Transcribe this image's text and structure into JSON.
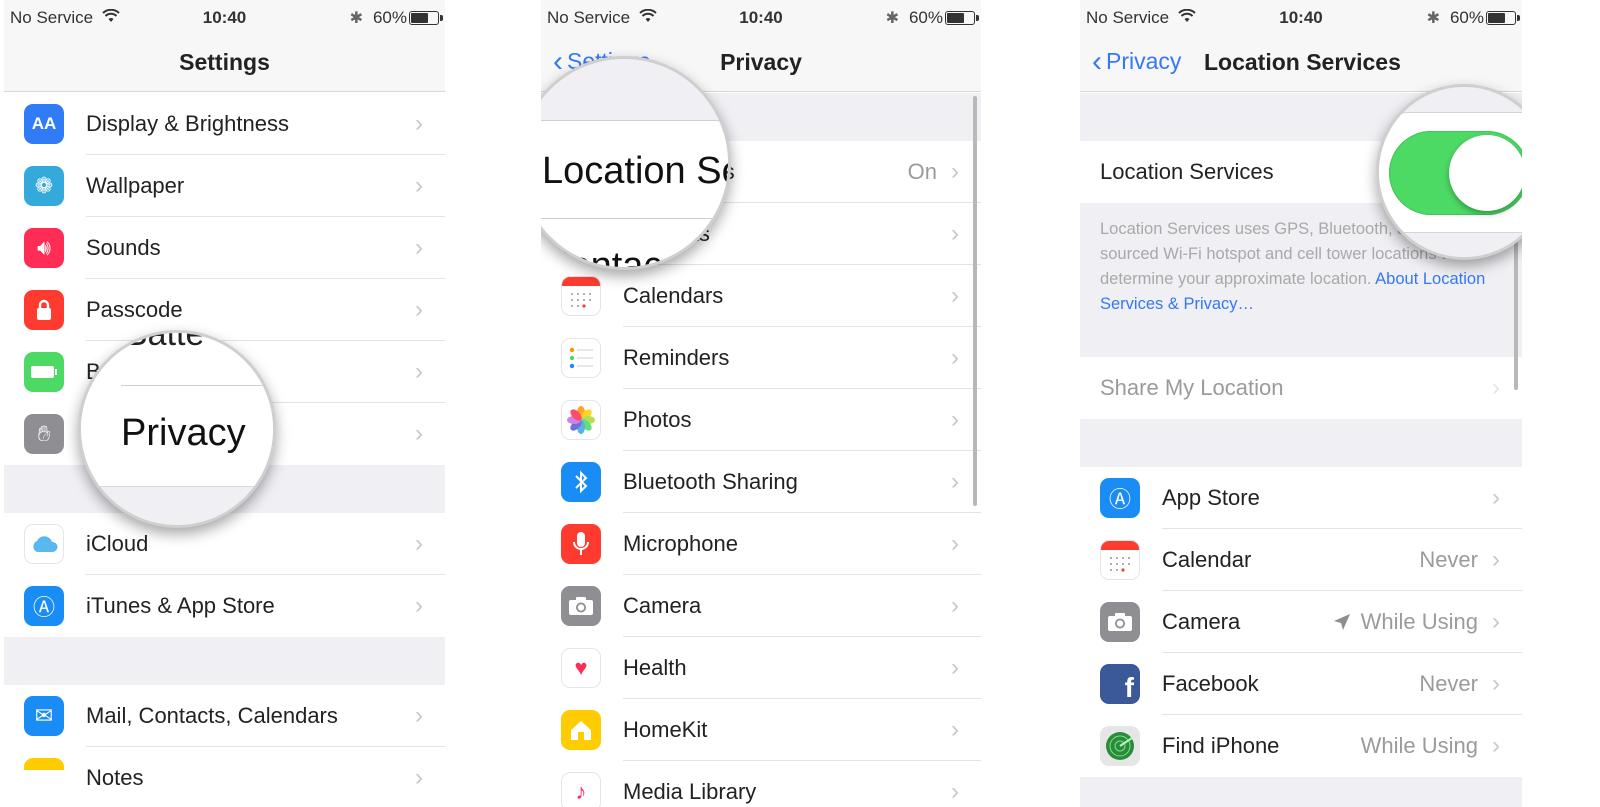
{
  "status": {
    "carrier": "No Service",
    "time": "10:40",
    "battery": "60%",
    "battery_level": 0.6
  },
  "panel1": {
    "title": "Settings",
    "rows": [
      {
        "label": "Display & Brightness",
        "icon": "display-brightness-icon",
        "color": "#2f7cf6"
      },
      {
        "label": "Wallpaper",
        "icon": "wallpaper-flower-icon",
        "color": "#34aadc"
      },
      {
        "label": "Sounds",
        "icon": "sounds-speaker-icon",
        "color": "#ff2d55"
      },
      {
        "label": "Passcode",
        "icon": "passcode-lock-icon",
        "color": "#ff3b30"
      },
      {
        "label": "B",
        "icon": "battery-icon",
        "color": "#4cd964"
      },
      {
        "label": "",
        "icon": "privacy-hand-icon",
        "color": "#8e8e93"
      },
      {
        "label": "iCloud",
        "icon": "icloud-icon",
        "color": "#ffffff"
      },
      {
        "label": "iTunes & App Store",
        "icon": "app-store-icon",
        "color": "#1a8cf5"
      },
      {
        "label": "Mail, Contacts, Calendars",
        "icon": "mail-icon",
        "color": "#1a8cf5"
      },
      {
        "label": "Notes",
        "icon": "notes-icon",
        "color": "#ffcc00"
      }
    ],
    "magnifier": {
      "label": "Privacy",
      "above": "Batte"
    }
  },
  "panel2": {
    "back": "Settings",
    "title": "Privacy",
    "rows": [
      {
        "label": "Location Services",
        "value": "On",
        "icon": "",
        "color": ""
      },
      {
        "label": "Contacts",
        "icon": "contacts-icon",
        "color": "#8e8e93"
      },
      {
        "label": "Calendars",
        "icon": "calendar-icon",
        "color": "#ffffff"
      },
      {
        "label": "Reminders",
        "icon": "reminders-icon",
        "color": "#ffffff"
      },
      {
        "label": "Photos",
        "icon": "photos-icon",
        "color": "#ffffff"
      },
      {
        "label": "Bluetooth Sharing",
        "icon": "bluetooth-icon",
        "color": "#1a8cf5"
      },
      {
        "label": "Microphone",
        "icon": "microphone-icon",
        "color": "#ff3b30"
      },
      {
        "label": "Camera",
        "icon": "camera-icon",
        "color": "#8e8e93"
      },
      {
        "label": "Health",
        "icon": "health-heart-icon",
        "color": "#ffffff"
      },
      {
        "label": "HomeKit",
        "icon": "homekit-house-icon",
        "color": "#ffcc00"
      },
      {
        "label": "Media Library",
        "icon": "music-icon",
        "color": "#ffffff"
      }
    ],
    "magnifier": {
      "label": "Location Se",
      "below": "Contac"
    }
  },
  "panel3": {
    "back": "Privacy",
    "title": "Location Services",
    "toggle_label": "Location Services",
    "toggle_on": true,
    "description": "Location Services uses GPS, Bluetooth, and crowd-sourced Wi-Fi hotspot and cell tower locations to determine your approximate location.",
    "description_link": "About Location Services & Privacy…",
    "share_label": "Share My Location",
    "apps": [
      {
        "label": "App Store",
        "value": "",
        "icon": "app-store-icon",
        "color": "#1a8cf5"
      },
      {
        "label": "Calendar",
        "value": "Never",
        "icon": "calendar-icon",
        "color": "#ffffff"
      },
      {
        "label": "Camera",
        "value": "While Using",
        "icon": "camera-icon",
        "color": "#8e8e93",
        "arrow": true
      },
      {
        "label": "Facebook",
        "value": "Never",
        "icon": "facebook-icon",
        "color": "#3b5998"
      },
      {
        "label": "Find iPhone",
        "value": "While Using",
        "icon": "find-iphone-radar-icon",
        "color": "#4cd964"
      }
    ]
  }
}
